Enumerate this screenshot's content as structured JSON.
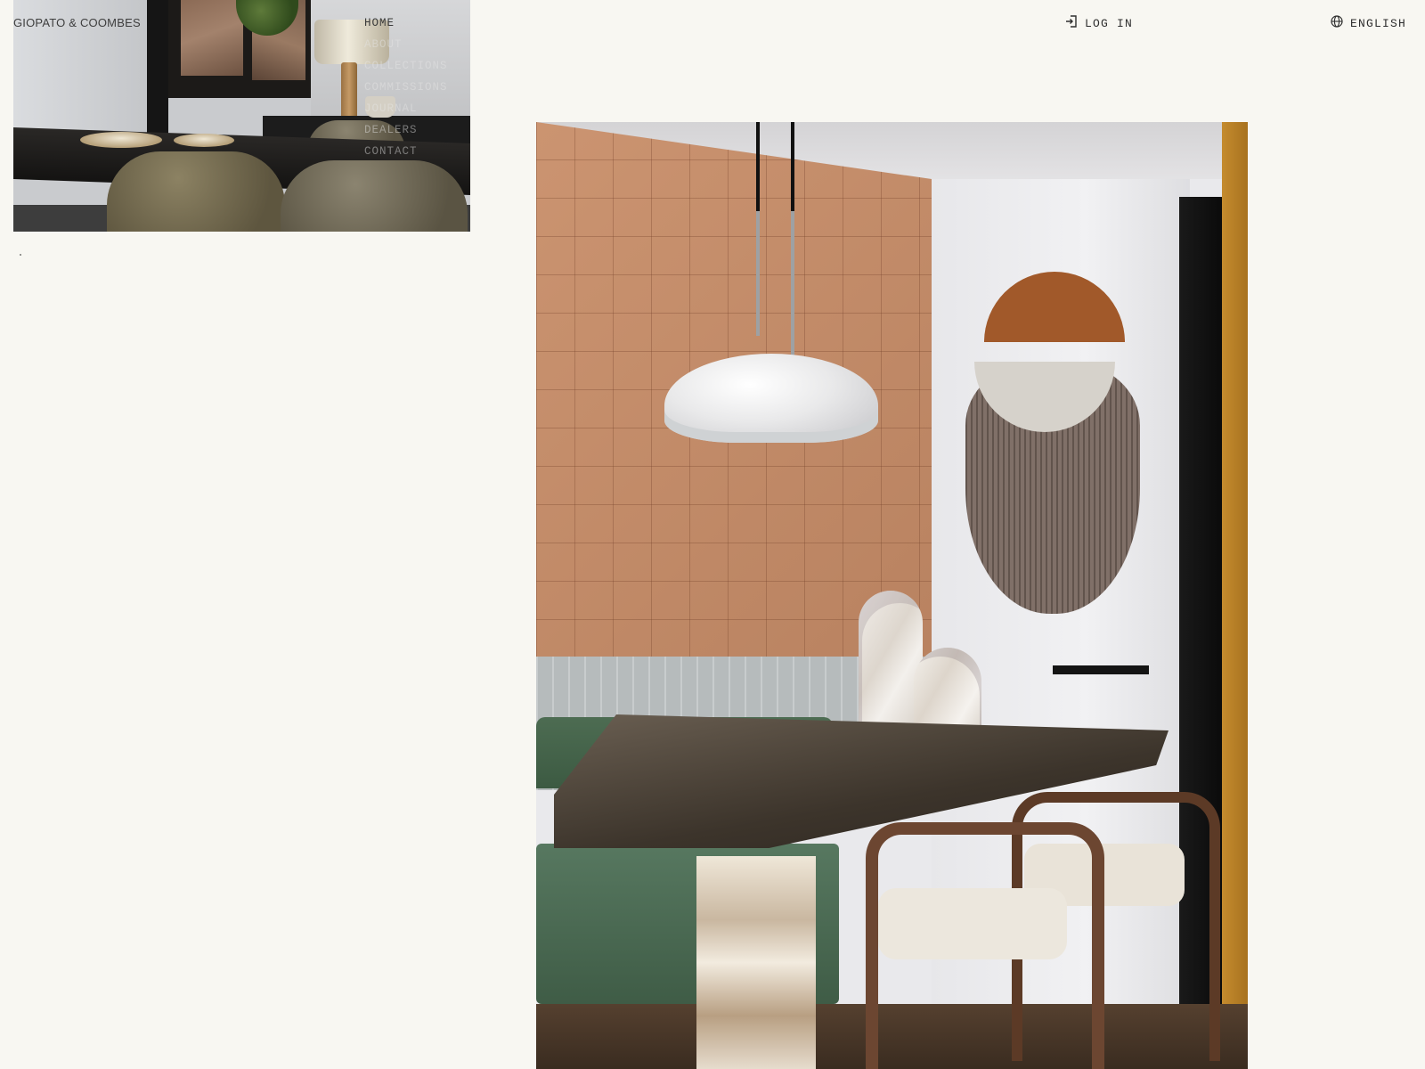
{
  "header": {
    "brand": "GIOPATO & COOMBES",
    "login_label": "LOG IN",
    "language_label": "ENGLISH"
  },
  "nav": {
    "items": [
      {
        "label": "HOME",
        "active": true
      },
      {
        "label": "ABOUT",
        "active": false
      },
      {
        "label": "COLLECTIONS",
        "active": false
      },
      {
        "label": "COMMISSIONS",
        "active": false
      },
      {
        "label": "JOURNAL",
        "active": false
      },
      {
        "label": "DEALERS",
        "active": false
      },
      {
        "label": "CONTACT",
        "active": false
      }
    ]
  },
  "icons": {
    "login": "login-icon",
    "language": "globe-icon"
  },
  "colors": {
    "background": "#f8f7f2",
    "text": "#2e2e2e",
    "terracotta": "#c48a66",
    "mustard": "#c48b2e",
    "sofa_green": "#4d6c52"
  }
}
